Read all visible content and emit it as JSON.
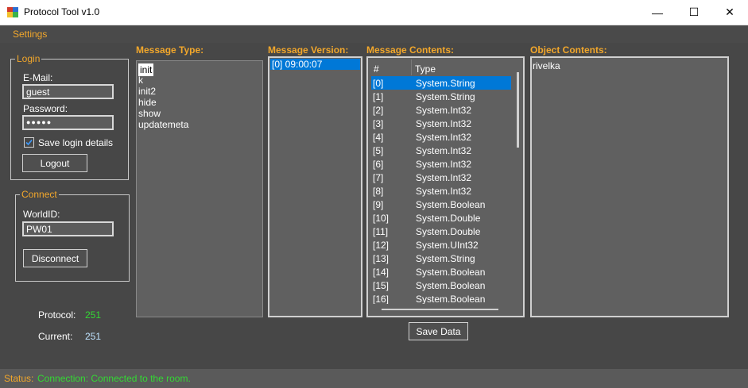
{
  "window": {
    "title": "Protocol Tool v1.0",
    "minimize_glyph": "—",
    "maximize_glyph": "☐",
    "close_glyph": "✕"
  },
  "menu": {
    "settings": "Settings"
  },
  "login": {
    "legend": "Login",
    "email_label": "E-Mail:",
    "email_value": "guest",
    "password_label": "Password:",
    "password_value": "●●●●●",
    "save_login_label": "Save login details",
    "save_login_checked": true,
    "logout_button": "Logout"
  },
  "connect": {
    "legend": "Connect",
    "worldid_label": "WorldID:",
    "worldid_value": "PW01",
    "disconnect_button": "Disconnect"
  },
  "info": {
    "protocol_label": "Protocol:",
    "protocol_value": "251",
    "current_label": "Current:",
    "current_value": "251"
  },
  "message_type": {
    "header": "Message Type:",
    "items": [
      "init",
      "k",
      "init2",
      "hide",
      "show",
      "updatemeta"
    ],
    "selected_index": 0
  },
  "message_version": {
    "header": "Message Version:",
    "items": [
      "[0] 09:00:07"
    ],
    "selected_index": 0
  },
  "message_contents": {
    "header": "Message Contents:",
    "col_index": "#",
    "col_type": "Type",
    "selected_index": 0,
    "rows": [
      {
        "idx": "[0]",
        "type": "System.String"
      },
      {
        "idx": "[1]",
        "type": "System.String"
      },
      {
        "idx": "[2]",
        "type": "System.Int32"
      },
      {
        "idx": "[3]",
        "type": "System.Int32"
      },
      {
        "idx": "[4]",
        "type": "System.Int32"
      },
      {
        "idx": "[5]",
        "type": "System.Int32"
      },
      {
        "idx": "[6]",
        "type": "System.Int32"
      },
      {
        "idx": "[7]",
        "type": "System.Int32"
      },
      {
        "idx": "[8]",
        "type": "System.Int32"
      },
      {
        "idx": "[9]",
        "type": "System.Boolean"
      },
      {
        "idx": "[10]",
        "type": "System.Double"
      },
      {
        "idx": "[11]",
        "type": "System.Double"
      },
      {
        "idx": "[12]",
        "type": "System.UInt32"
      },
      {
        "idx": "[13]",
        "type": "System.String"
      },
      {
        "idx": "[14]",
        "type": "System.Boolean"
      },
      {
        "idx": "[15]",
        "type": "System.Boolean"
      },
      {
        "idx": "[16]",
        "type": "System.Boolean"
      }
    ]
  },
  "object_contents": {
    "header": "Object Contents:",
    "value": "rivelka"
  },
  "save_data_button": "Save Data",
  "status": {
    "label": "Status:",
    "text": "Connection: Connected to the room."
  },
  "colors": {
    "accent": "#f2a72b",
    "selection": "#0078d7",
    "status_ok": "#33d933"
  }
}
